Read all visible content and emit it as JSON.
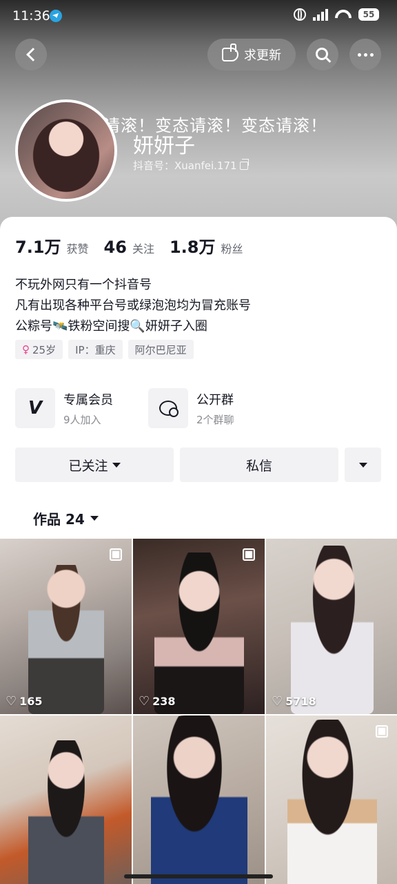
{
  "status_bar": {
    "time": "11:36",
    "battery": "55"
  },
  "nav": {
    "update_label": "求更新"
  },
  "profile": {
    "marquee": "请滚！变态请滚！变态请滚！",
    "nickname": "妍妍子",
    "douyin_id": "抖音号：Xuanfei.171"
  },
  "stats": {
    "likes": {
      "value": "7.1万",
      "label": "获赞"
    },
    "following": {
      "value": "46",
      "label": "关注"
    },
    "followers": {
      "value": "1.8万",
      "label": "粉丝"
    }
  },
  "bio": {
    "line1": "不玩外网只有一个抖音号",
    "line2": "凡有出现各种平台号或绿泡泡均为冒充账号",
    "line3": "公粽号🛰️铁粉空间搜🔍妍妍子入圈"
  },
  "tags": {
    "age": "25岁",
    "ip": "IP：重庆",
    "location": "阿尔巴尼亚"
  },
  "features": {
    "membership": {
      "title": "专属会员",
      "subtitle": "9人加入"
    },
    "group": {
      "title": "公开群",
      "subtitle": "2个群聊"
    }
  },
  "actions": {
    "follow_label": "已关注",
    "message_label": "私信"
  },
  "works_tab": {
    "label": "作品 24"
  },
  "videos": [
    {
      "likes": "165",
      "multi": true
    },
    {
      "likes": "238",
      "multi": true
    },
    {
      "likes": "5718",
      "multi": false
    },
    {
      "likes": "",
      "multi": false
    },
    {
      "likes": "",
      "multi": false
    },
    {
      "likes": "",
      "multi": true
    }
  ],
  "colors": {
    "accent_female": "#f0408c",
    "sheet_bg": "#ffffff",
    "button_bg": "#f2f2f4"
  }
}
